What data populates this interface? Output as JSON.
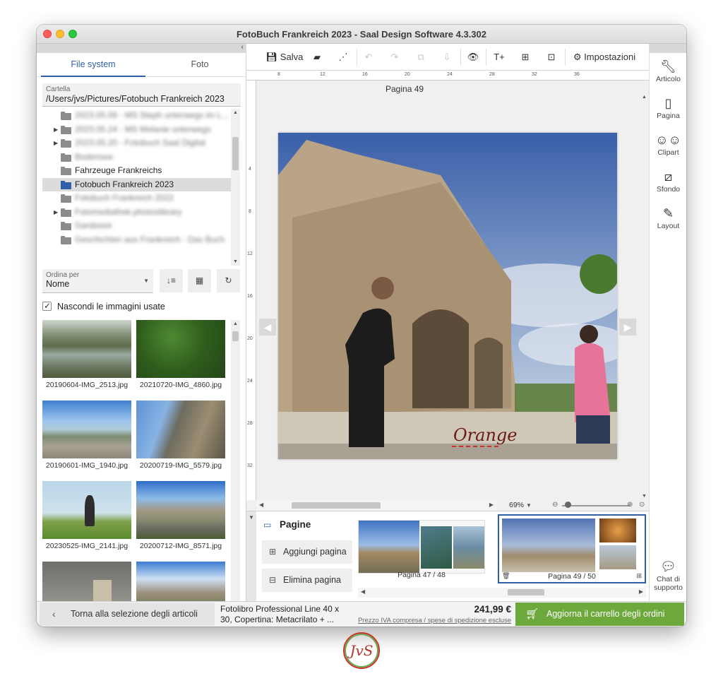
{
  "window": {
    "title": "FotoBuch Frankreich 2023 - Saal Design Software 4.3.302"
  },
  "left_panel": {
    "tabs": [
      {
        "label": "File system",
        "active": true
      },
      {
        "label": "Foto",
        "active": false
      }
    ],
    "folder_label": "Cartella",
    "folder_path": "/Users/jvs/Pictures/Fotobuch Frankreich 2023",
    "tree": [
      {
        "label": "2023.05.09 - MS Steph unterwegs im L...",
        "blurred": true,
        "expand": false
      },
      {
        "label": "2023.05.24 - MS Melanie unterwegs",
        "blurred": true,
        "expand": true
      },
      {
        "label": "2023.05.20 - Fotobuch Saal Digital",
        "blurred": true,
        "expand": true
      },
      {
        "label": "Bodensee",
        "blurred": true,
        "expand": false
      },
      {
        "label": "Fahrzeuge Frankreichs",
        "blurred": false,
        "expand": false
      },
      {
        "label": "Fotobuch Frankreich 2023",
        "blurred": false,
        "expand": false,
        "selected": true
      },
      {
        "label": "Fotobuch Frankreich 2022",
        "blurred": true,
        "expand": false
      },
      {
        "label": "Fotomediathek.photoslibrary",
        "blurred": true,
        "expand": true
      },
      {
        "label": "Gardasee",
        "blurred": true,
        "expand": false
      },
      {
        "label": "Geschichten aus Frankreich - Das Buch",
        "blurred": true,
        "expand": false
      }
    ],
    "sort_label": "Ordina per",
    "sort_value": "Nome",
    "hide_used_label": "Nascondi le immagini usate",
    "hide_used_checked": true,
    "thumbnails": [
      {
        "caption": "20190604-IMG_2513.jpg"
      },
      {
        "caption": "20210720-IMG_4860.jpg"
      },
      {
        "caption": "20190601-IMG_1940.jpg"
      },
      {
        "caption": "20200719-IMG_5579.jpg"
      },
      {
        "caption": "20230525-IMG_2141.jpg"
      },
      {
        "caption": "20200712-IMG_8571.jpg"
      },
      {
        "caption": ""
      },
      {
        "caption": ""
      }
    ]
  },
  "toolbar": {
    "save_label": "Salva",
    "settings_label": "Impostazioni"
  },
  "right_panel": {
    "items": [
      {
        "label": "Articolo",
        "icon": "wrench-icon"
      },
      {
        "label": "Pagina",
        "icon": "page-icon"
      },
      {
        "label": "Clipart",
        "icon": "clipart-icon"
      },
      {
        "label": "Sfondo",
        "icon": "background-icon"
      },
      {
        "label": "Layout",
        "icon": "brush-icon"
      }
    ],
    "chat_label": "Chat di supporto"
  },
  "canvas": {
    "page_label": "Pagina 49",
    "photo_text": "Orange",
    "zoom": "69%",
    "ruler_top": [
      "8",
      "12",
      "16",
      "20",
      "24",
      "28",
      "32",
      "36"
    ],
    "ruler_left": [
      "4",
      "8",
      "12",
      "16",
      "20",
      "24",
      "28",
      "32"
    ]
  },
  "pages_panel": {
    "title": "Pagine",
    "add_label": "Aggiungi pagina",
    "delete_label": "Elimina pagina",
    "spreads": [
      {
        "caption": "Pagina 47 / 48",
        "selected": false
      },
      {
        "caption": "Pagina 49 / 50",
        "selected": true
      }
    ]
  },
  "footer": {
    "back_label": "Torna alla selezione degli articoli",
    "product": "Fotolibro Professional Line 40 x 30, Copertina: Metacrilato + ...",
    "price": "241,99 €",
    "price_note": "Prezzo IVA compresa / spese di spedizione escluse",
    "cart_label": "Aggiorna il carrello degli ordini"
  },
  "colors": {
    "accent_blue": "#2f5fa7",
    "cart_green": "#6ca83b"
  },
  "watermark": "JvS"
}
